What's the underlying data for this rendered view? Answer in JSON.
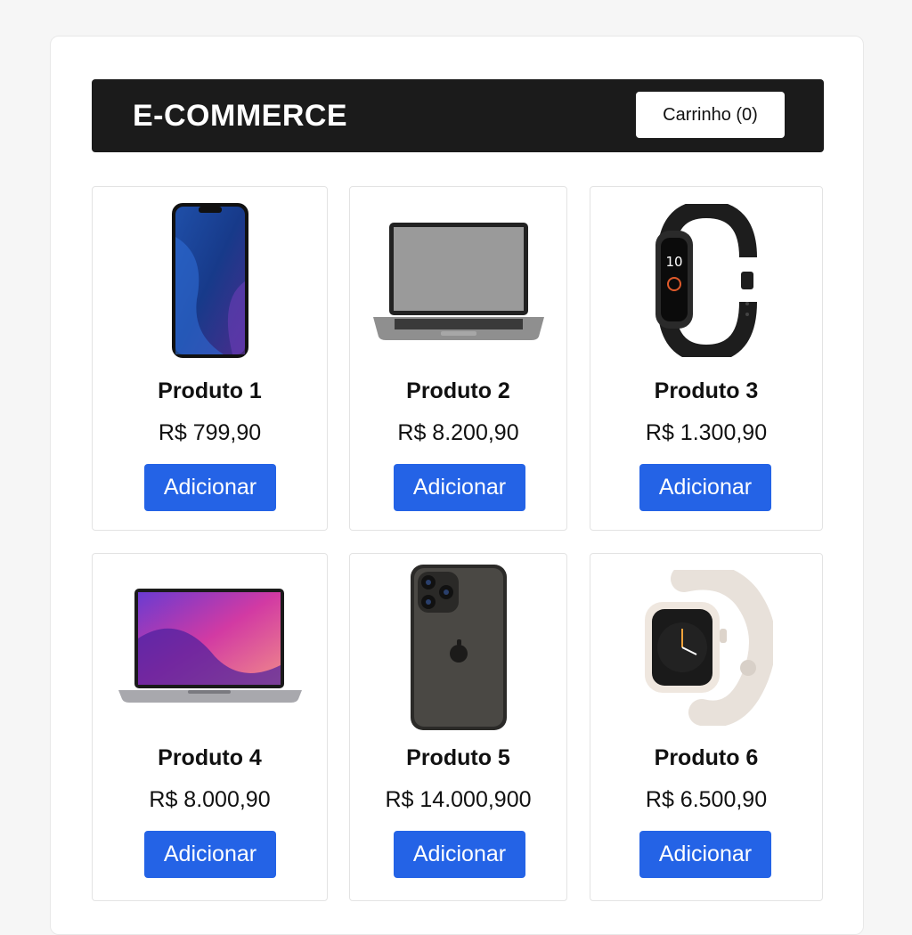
{
  "header": {
    "brand": "E-COMMERCE",
    "cart_label": "Carrinho (0)"
  },
  "colors": {
    "header_bg": "#1b1b1b",
    "button_bg": "#2463e6",
    "card_border": "#e3e3e3"
  },
  "products": [
    {
      "name": "Produto 1",
      "price": "R$ 799,90",
      "button": "Adicionar",
      "icon": "smartphone-icon"
    },
    {
      "name": "Produto 2",
      "price": "R$ 8.200,90",
      "button": "Adicionar",
      "icon": "laptop-icon"
    },
    {
      "name": "Produto 3",
      "price": "R$ 1.300,90",
      "button": "Adicionar",
      "icon": "fitness-band-icon"
    },
    {
      "name": "Produto 4",
      "price": "R$ 8.000,90",
      "button": "Adicionar",
      "icon": "laptop-icon"
    },
    {
      "name": "Produto 5",
      "price": "R$ 14.000,900",
      "button": "Adicionar",
      "icon": "smartphone-icon"
    },
    {
      "name": "Produto 6",
      "price": "R$ 6.500,90",
      "button": "Adicionar",
      "icon": "smartwatch-icon"
    }
  ]
}
